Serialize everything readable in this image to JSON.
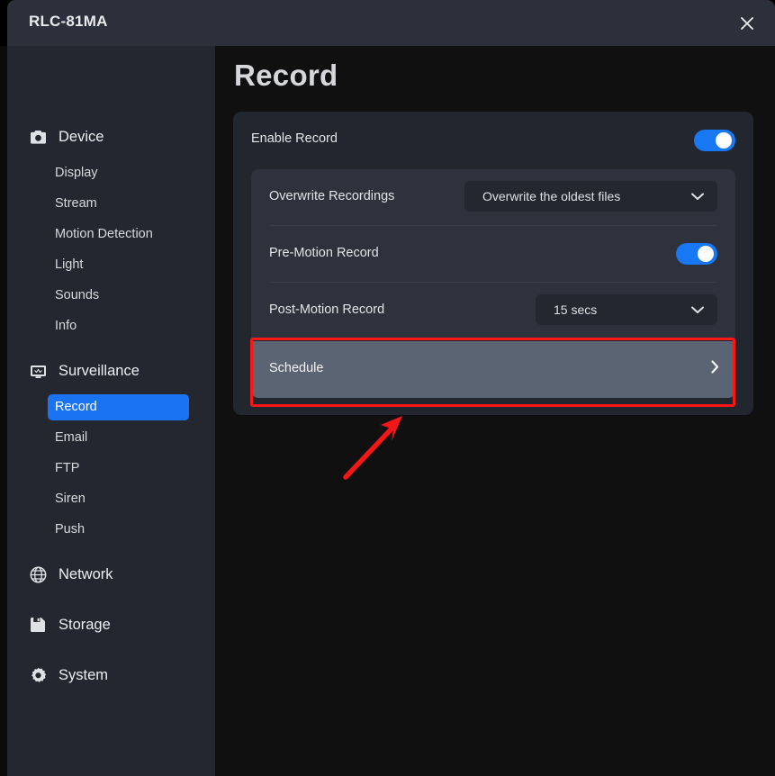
{
  "window": {
    "title": "RLC-81MA",
    "close_icon": "close-icon"
  },
  "sidebar": {
    "groups": [
      {
        "label": "Device",
        "icon": "camera-icon",
        "items": [
          {
            "label": "Display",
            "active": false
          },
          {
            "label": "Stream",
            "active": false
          },
          {
            "label": "Motion Detection",
            "active": false
          },
          {
            "label": "Light",
            "active": false
          },
          {
            "label": "Sounds",
            "active": false
          },
          {
            "label": "Info",
            "active": false
          }
        ]
      },
      {
        "label": "Surveillance",
        "icon": "monitor-icon",
        "items": [
          {
            "label": "Record",
            "active": true
          },
          {
            "label": "Email",
            "active": false
          },
          {
            "label": "FTP",
            "active": false
          },
          {
            "label": "Siren",
            "active": false
          },
          {
            "label": "Push",
            "active": false
          }
        ]
      },
      {
        "label": "Network",
        "icon": "globe-icon",
        "items": []
      },
      {
        "label": "Storage",
        "icon": "save-icon",
        "items": []
      },
      {
        "label": "System",
        "icon": "gear-icon",
        "items": []
      }
    ]
  },
  "main": {
    "page_title": "Record",
    "enable_record": {
      "label": "Enable Record",
      "toggle_on": true
    },
    "overwrite_recordings": {
      "label": "Overwrite Recordings",
      "value": "Overwrite the oldest files",
      "chevron_icon": "chevron-down-icon"
    },
    "pre_motion_record": {
      "label": "Pre-Motion Record",
      "toggle_on": true
    },
    "post_motion_record": {
      "label": "Post-Motion Record",
      "value": "15 secs",
      "chevron_icon": "chevron-down-icon"
    },
    "schedule": {
      "label": "Schedule",
      "arrow_icon": "chevron-right-icon"
    }
  },
  "annotations": {
    "highlight_color": "#fc1717",
    "arrow_color": "#f51717",
    "highlight_target": "schedule-row",
    "arrow_points_to": "schedule-row"
  },
  "colors": {
    "accent_blue": "#1877f2",
    "sidebar_bg": "#24272f",
    "titlebar_bg": "#2b303a",
    "main_bg": "#101010",
    "card_bg": "#22262e",
    "inner_card_bg": "#2d323c",
    "hover_row_bg": "#5b6472",
    "select_bg": "#23272f"
  }
}
